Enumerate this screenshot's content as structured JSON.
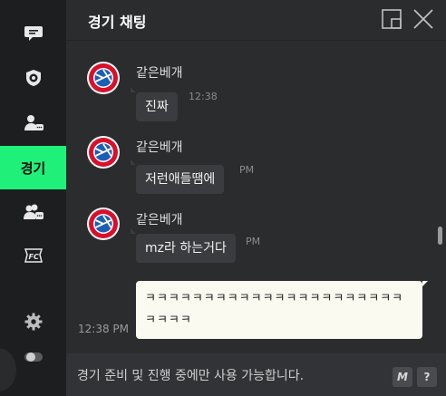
{
  "sidebar": {
    "items": [
      {
        "icon": "chat-bubble-icon"
      },
      {
        "icon": "shield-ball-icon"
      },
      {
        "icon": "user-chat-icon"
      },
      {
        "label": "경기",
        "active": true
      },
      {
        "icon": "group-chat-icon"
      },
      {
        "icon": "fc-logo-icon"
      }
    ],
    "settings_icon": "gear-icon",
    "toggle_icon": "toggle-icon"
  },
  "header": {
    "title": "경기 채팅",
    "popout_icon": "popout-icon",
    "close_icon": "close-icon"
  },
  "messages": [
    {
      "nick": "같은베개",
      "text": "진짜",
      "time": "12:38"
    },
    {
      "nick": "같은베개",
      "text": "저런애들땜에",
      "time": "PM"
    },
    {
      "nick": "같은베개",
      "text": "mz라 하는거다",
      "time": "PM"
    }
  ],
  "my_message": {
    "text": "ㅋㅋㅋㅋㅋㅋㅋㅋㅋㅋㅋㅋㅋㅋㅋㅋㅋㅋㅋㅋㅋㅋㅋㅋㅋㅋ",
    "time": "12:38 PM"
  },
  "footer": {
    "notice": "경기 준비 및 진행 중에만 사용 가능합니다.",
    "macro_label": "M",
    "help_label": "?"
  },
  "colors": {
    "accent": "#1ff07a",
    "sidebar_bg": "#1d1e20",
    "chat_bg": "#2b2c2e",
    "bubble_bg": "#3b3c3f",
    "my_bubble_bg": "#fbfaf0"
  }
}
